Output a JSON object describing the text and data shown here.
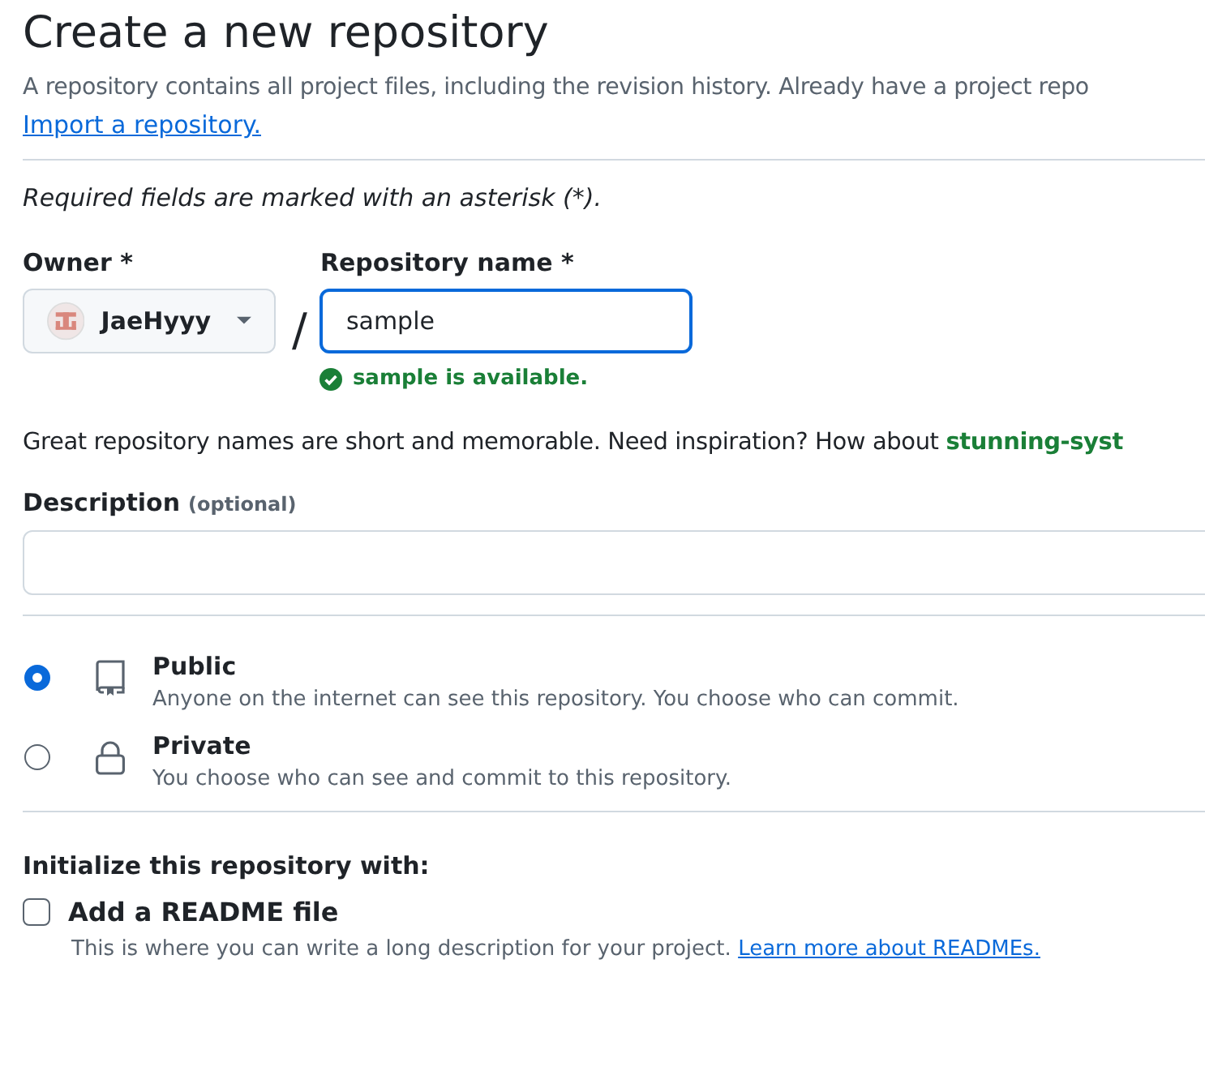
{
  "title": "Create a new repository",
  "intro": "A repository contains all project files, including the revision history. Already have a project repo",
  "import_link": "Import a repository.",
  "required_note": "Required fields are marked with an asterisk (*).",
  "owner": {
    "label": "Owner *",
    "value": "JaeHyyy"
  },
  "separator": "/",
  "repo_name": {
    "label": "Repository name *",
    "value": "sample",
    "focused": true,
    "availability": "sample is available."
  },
  "suggestion": "Great repository names are short and memorable. Need inspiration? How about **stunning-syst**",
  "description": {
    "label": "Description",
    "hint": "(optional)"
  },
  "visibility": [
    {
      "kind": "public",
      "label": "Public",
      "detail": "Anyone on the internet can see this repository. You choose who can commit.",
      "selected": true
    },
    {
      "kind": "private",
      "label": "Private",
      "detail": "You choose who can see and commit to this repository.",
      "selected": false
    }
  ],
  "initialize": {
    "heading": "Initialize this repository with:",
    "options": [
      {
        "label": "Add a README file",
        "detail": "This is where you can write a long description for your project.",
        "link": "Learn more about READMEs.",
        "checked": false
      }
    ]
  }
}
